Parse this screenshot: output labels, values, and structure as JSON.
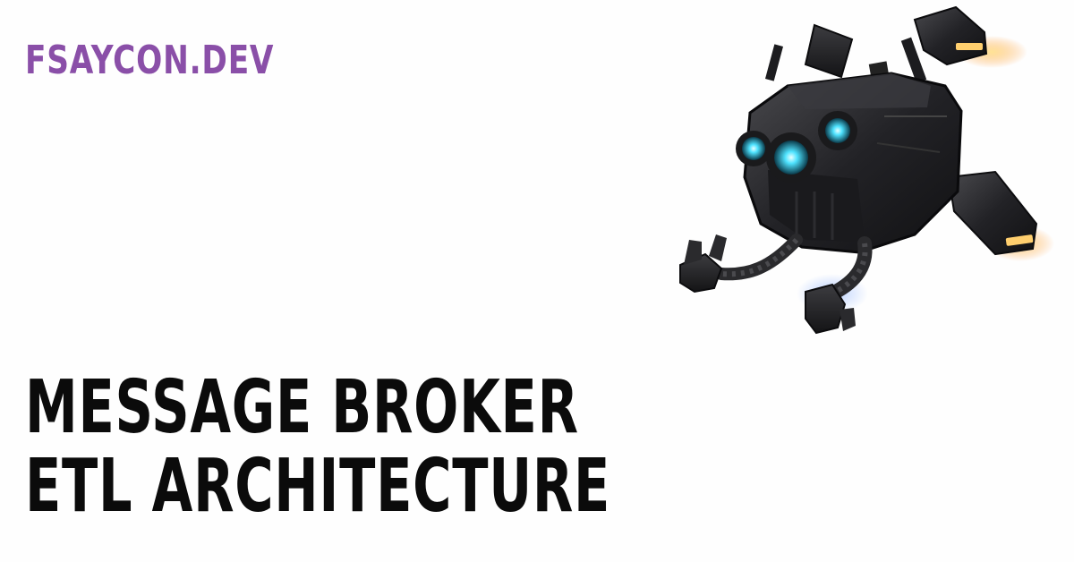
{
  "brand": {
    "text": "FSAYCON.DEV",
    "color": "#8a4fa8"
  },
  "title": {
    "line1": "MESSAGE BROKER",
    "line2": "ETL ARCHITECTURE",
    "color": "#0b0b0b"
  },
  "illustration": {
    "name": "flying-robot-drone",
    "eye_color": "#4fe3ff",
    "light_color": "#ffb347"
  }
}
